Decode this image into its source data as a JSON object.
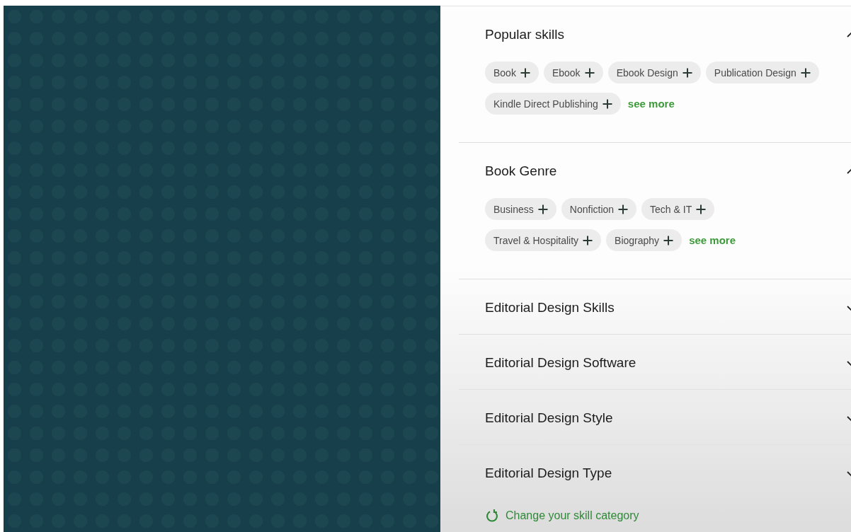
{
  "sections": [
    {
      "title": "Popular skills",
      "expanded": true,
      "chips": [
        "Book",
        "Ebook",
        "Ebook Design",
        "Publication Design",
        "Kindle Direct Publishing"
      ],
      "see_more": "see more"
    },
    {
      "title": "Book Genre",
      "expanded": true,
      "chips": [
        "Business",
        "Nonfiction",
        "Tech & IT",
        "Travel & Hospitality",
        "Biography"
      ],
      "see_more": "see more"
    },
    {
      "title": "Editorial Design Skills",
      "expanded": false
    },
    {
      "title": "Editorial Design Software",
      "expanded": false
    },
    {
      "title": "Editorial Design Style",
      "expanded": false
    },
    {
      "title": "Editorial Design Type",
      "expanded": false
    }
  ],
  "change_link": "Change your skill category"
}
